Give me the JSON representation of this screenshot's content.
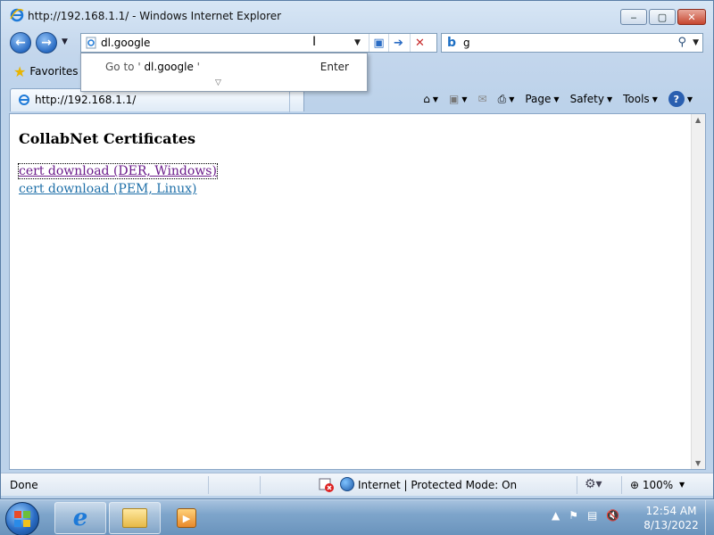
{
  "window": {
    "title": "http://192.168.1.1/ - Windows Internet Explorer",
    "minimize": "‒",
    "maximize": "▢",
    "close": "✕"
  },
  "address_bar": {
    "value": "dl.google",
    "autocomplete": {
      "prefix": "Go to '",
      "query": " dl.google",
      "suffix": " '",
      "hint": "Enter"
    }
  },
  "search": {
    "value": "g",
    "logo": "b"
  },
  "favorites": {
    "label": "Favorites"
  },
  "tab": {
    "label": "http://192.168.1.1/"
  },
  "command_bar": {
    "page": "Page",
    "safety": "Safety",
    "tools": "Tools",
    "help": "?"
  },
  "page": {
    "title": "CollabNet Certificates",
    "links": [
      "cert download (DER, Windows)",
      "cert download (PEM, Linux)"
    ]
  },
  "status_bar": {
    "status": "Done",
    "zone": "Internet | Protected Mode: On",
    "zoom": "100%"
  },
  "taskbar": {
    "time": "12:54 AM",
    "date": "8/13/2022"
  }
}
